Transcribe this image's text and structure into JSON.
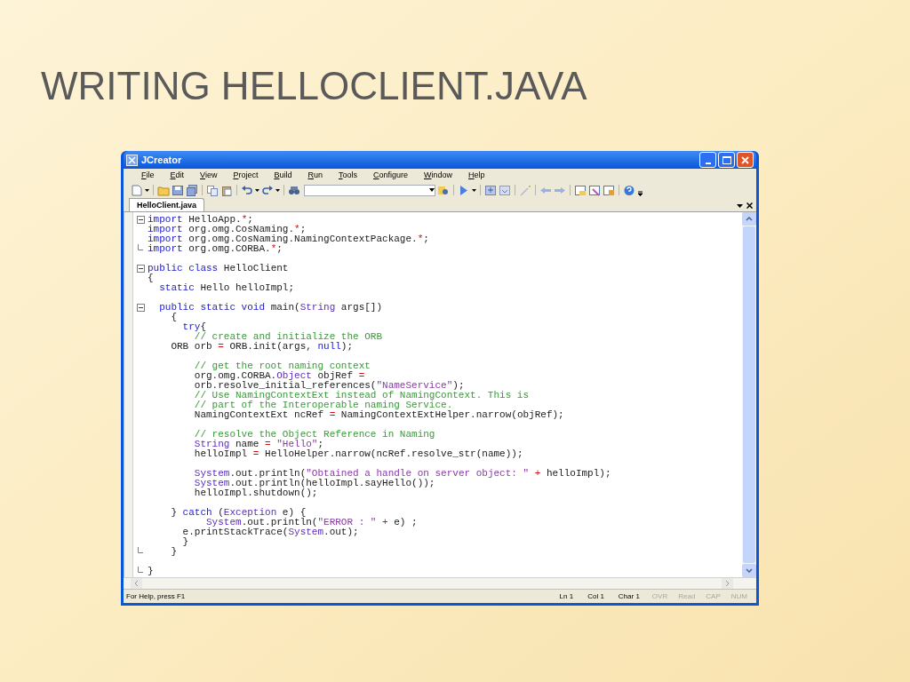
{
  "slide_title": "WRITING HELLOCLIENT.JAVA",
  "window": {
    "title": "JCreator"
  },
  "menu": [
    "File",
    "Edit",
    "View",
    "Project",
    "Build",
    "Run",
    "Tools",
    "Configure",
    "Window",
    "Help"
  ],
  "tabs": [
    {
      "label": "HelloClient.java",
      "selected": true
    }
  ],
  "code": [
    {
      "kind": "fold-start",
      "tokens": [
        {
          "kind": "kw",
          "text": "import"
        },
        {
          "kind": "plain",
          "text": " HelloApp."
        },
        {
          "kind": "op",
          "text": "*"
        },
        {
          "kind": "plain",
          "text": ";"
        }
      ]
    },
    {
      "kind": "line",
      "tokens": [
        {
          "kind": "kw",
          "text": "import"
        },
        {
          "kind": "plain",
          "text": " org.omg.CosNaming."
        },
        {
          "kind": "op",
          "text": "*"
        },
        {
          "kind": "plain",
          "text": ";"
        }
      ]
    },
    {
      "kind": "line",
      "tokens": [
        {
          "kind": "kw",
          "text": "import"
        },
        {
          "kind": "plain",
          "text": " org.omg.CosNaming.NamingContextPackage."
        },
        {
          "kind": "op",
          "text": "*"
        },
        {
          "kind": "plain",
          "text": ";"
        }
      ]
    },
    {
      "kind": "fold-end",
      "tokens": [
        {
          "kind": "kw",
          "text": "import"
        },
        {
          "kind": "plain",
          "text": " org.omg.CORBA."
        },
        {
          "kind": "op",
          "text": "*"
        },
        {
          "kind": "plain",
          "text": ";"
        }
      ]
    },
    {
      "kind": "blank"
    },
    {
      "kind": "fold-start",
      "tokens": [
        {
          "kind": "kw",
          "text": "public class"
        },
        {
          "kind": "plain",
          "text": " HelloClient"
        }
      ]
    },
    {
      "kind": "line",
      "tokens": [
        {
          "kind": "plain",
          "text": "{"
        }
      ]
    },
    {
      "kind": "line",
      "tokens": [
        {
          "kind": "kw",
          "text": "  static"
        },
        {
          "kind": "plain",
          "text": " Hello helloImpl;"
        }
      ]
    },
    {
      "kind": "blank"
    },
    {
      "kind": "fold-start",
      "tokens": [
        {
          "kind": "kw",
          "text": "  public static void"
        },
        {
          "kind": "plain",
          "text": " main("
        },
        {
          "kind": "type",
          "text": "String"
        },
        {
          "kind": "plain",
          "text": " args[])"
        }
      ]
    },
    {
      "kind": "line",
      "tokens": [
        {
          "kind": "plain",
          "text": "    {"
        }
      ]
    },
    {
      "kind": "line",
      "tokens": [
        {
          "kind": "kw",
          "text": "      try"
        },
        {
          "kind": "plain",
          "text": "{"
        }
      ]
    },
    {
      "kind": "line",
      "tokens": [
        {
          "kind": "cm",
          "text": "        // create and initialize the ORB"
        }
      ]
    },
    {
      "kind": "line",
      "tokens": [
        {
          "kind": "plain",
          "text": "    ORB orb "
        },
        {
          "kind": "op",
          "text": "="
        },
        {
          "kind": "plain",
          "text": " ORB.init(args, "
        },
        {
          "kind": "kw",
          "text": "null"
        },
        {
          "kind": "plain",
          "text": ");"
        }
      ]
    },
    {
      "kind": "blank"
    },
    {
      "kind": "line",
      "tokens": [
        {
          "kind": "cm",
          "text": "        // get the root naming context"
        }
      ]
    },
    {
      "kind": "line",
      "tokens": [
        {
          "kind": "plain",
          "text": "        org.omg.CORBA."
        },
        {
          "kind": "type",
          "text": "Object"
        },
        {
          "kind": "plain",
          "text": " objRef "
        },
        {
          "kind": "op",
          "text": "="
        }
      ]
    },
    {
      "kind": "line",
      "tokens": [
        {
          "kind": "plain",
          "text": "        orb.resolve_initial_references("
        },
        {
          "kind": "str",
          "text": "\"NameService\""
        },
        {
          "kind": "plain",
          "text": ");"
        }
      ]
    },
    {
      "kind": "line",
      "tokens": [
        {
          "kind": "cm",
          "text": "        // Use NamingContextExt instead of NamingContext. This is"
        }
      ]
    },
    {
      "kind": "line",
      "tokens": [
        {
          "kind": "cm",
          "text": "        // part of the Interoperable naming Service."
        }
      ]
    },
    {
      "kind": "line",
      "tokens": [
        {
          "kind": "plain",
          "text": "        NamingContextExt ncRef "
        },
        {
          "kind": "op",
          "text": "="
        },
        {
          "kind": "plain",
          "text": " NamingContextExtHelper.narrow(objRef);"
        }
      ]
    },
    {
      "kind": "blank"
    },
    {
      "kind": "line",
      "tokens": [
        {
          "kind": "cm",
          "text": "        // resolve the Object Reference in Naming"
        }
      ]
    },
    {
      "kind": "line",
      "tokens": [
        {
          "kind": "type",
          "text": "        String"
        },
        {
          "kind": "plain",
          "text": " name "
        },
        {
          "kind": "op",
          "text": "="
        },
        {
          "kind": "str",
          "text": " \"Hello\""
        },
        {
          "kind": "plain",
          "text": ";"
        }
      ]
    },
    {
      "kind": "line",
      "tokens": [
        {
          "kind": "plain",
          "text": "        helloImpl "
        },
        {
          "kind": "op",
          "text": "="
        },
        {
          "kind": "plain",
          "text": " HelloHelper.narrow(ncRef.resolve_str(name));"
        }
      ]
    },
    {
      "kind": "blank"
    },
    {
      "kind": "line",
      "tokens": [
        {
          "kind": "type",
          "text": "        System"
        },
        {
          "kind": "plain",
          "text": ".out.println("
        },
        {
          "kind": "str",
          "text": "\"Obtained a handle on server object: \""
        },
        {
          "kind": "op",
          "text": " +"
        },
        {
          "kind": "plain",
          "text": " helloImpl);"
        }
      ]
    },
    {
      "kind": "line",
      "tokens": [
        {
          "kind": "type",
          "text": "        System"
        },
        {
          "kind": "plain",
          "text": ".out.println(helloImpl.sayHello());"
        }
      ]
    },
    {
      "kind": "line",
      "tokens": [
        {
          "kind": "plain",
          "text": "        helloImpl.shutdown();"
        }
      ]
    },
    {
      "kind": "blank"
    },
    {
      "kind": "line",
      "tokens": [
        {
          "kind": "plain",
          "text": "    } "
        },
        {
          "kind": "kw",
          "text": "catch"
        },
        {
          "kind": "plain",
          "text": " ("
        },
        {
          "kind": "type",
          "text": "Exception"
        },
        {
          "kind": "plain",
          "text": " e) {"
        }
      ]
    },
    {
      "kind": "line",
      "tokens": [
        {
          "kind": "type",
          "text": "          System"
        },
        {
          "kind": "plain",
          "text": ".out.println("
        },
        {
          "kind": "str",
          "text": "\"ERROR : \""
        },
        {
          "kind": "op",
          "text": " +"
        },
        {
          "kind": "plain",
          "text": " e) ;"
        }
      ]
    },
    {
      "kind": "line",
      "tokens": [
        {
          "kind": "plain",
          "text": "      e.printStackTrace("
        },
        {
          "kind": "type",
          "text": "System"
        },
        {
          "kind": "plain",
          "text": ".out);"
        }
      ]
    },
    {
      "kind": "line",
      "tokens": [
        {
          "kind": "plain",
          "text": "      }"
        }
      ]
    },
    {
      "kind": "fold-end",
      "tokens": [
        {
          "kind": "plain",
          "text": "    }"
        }
      ]
    },
    {
      "kind": "blank"
    },
    {
      "kind": "fold-end",
      "tokens": [
        {
          "kind": "plain",
          "text": "}"
        }
      ]
    }
  ],
  "status_bar": {
    "help": "For Help, press F1",
    "panes": [
      {
        "text": "Ln 1",
        "disabled": false
      },
      {
        "text": "Col 1",
        "disabled": false
      },
      {
        "text": "Char 1",
        "disabled": false
      },
      {
        "text": "OVR",
        "disabled": true
      },
      {
        "text": "Read",
        "disabled": true
      },
      {
        "text": "CAP",
        "disabled": true
      },
      {
        "text": "NUM",
        "disabled": true
      }
    ]
  }
}
